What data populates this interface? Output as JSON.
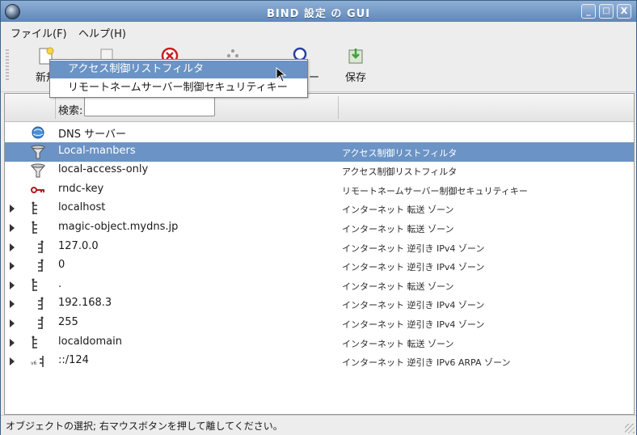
{
  "window": {
    "title": "BIND 設定 の GUI",
    "controls": [
      "_",
      "□",
      "X"
    ]
  },
  "menu": {
    "file": "ファイル(F)",
    "help": "ヘルプ(H)"
  },
  "toolbar": {
    "new_label": "新規",
    "partial_label": "ー",
    "save_label": "保存"
  },
  "popup": {
    "items": [
      "アクセス制御リストフィルタ",
      "リモートネームサーバー制御セキュリティキー"
    ]
  },
  "search": {
    "label": "検索:",
    "value": ""
  },
  "rows": [
    {
      "name": "DNS サーバー",
      "type": "",
      "icon": "globe-icon",
      "expandable": false
    },
    {
      "name": "Local-manbers",
      "type": "アクセス制御リストフィルタ",
      "icon": "filter-funnel-icon",
      "expandable": false
    },
    {
      "name": "local-access-only",
      "type": "アクセス制御リストフィルタ",
      "icon": "filter-funnel-icon",
      "expandable": false
    },
    {
      "name": "rndc-key",
      "type": "リモートネームサーバー制御セキュリティキー",
      "icon": "key-icon",
      "expandable": false
    },
    {
      "name": "localhost",
      "type": "インターネット 転送 ゾーン",
      "icon": "zone-tree-icon",
      "expandable": true
    },
    {
      "name": "magic-object.mydns.jp",
      "type": "インターネット 転送 ゾーン",
      "icon": "zone-tree-icon",
      "expandable": true
    },
    {
      "name": "127.0.0",
      "type": "インターネット 逆引き IPv4 ゾーン",
      "icon": "reverse-zone-icon",
      "expandable": true
    },
    {
      "name": "0",
      "type": "インターネット 逆引き IPv4 ゾーン",
      "icon": "reverse-zone-icon",
      "expandable": true
    },
    {
      "name": ".",
      "type": "インターネット 転送 ゾーン",
      "icon": "zone-tree-icon",
      "expandable": true
    },
    {
      "name": "192.168.3",
      "type": "インターネット 逆引き IPv4 ゾーン",
      "icon": "reverse-zone-icon",
      "expandable": true
    },
    {
      "name": "255",
      "type": "インターネット 逆引き IPv4 ゾーン",
      "icon": "reverse-zone-icon",
      "expandable": true
    },
    {
      "name": "localdomain",
      "type": "インターネット 転送 ゾーン",
      "icon": "zone-tree-icon",
      "expandable": true
    },
    {
      "name": "::/124",
      "type": "インターネット 逆引き IPv6 ARPA ゾーン",
      "icon": "ipv6-zone-icon",
      "expandable": true
    }
  ],
  "status": {
    "text": "オブジェクトの選択; 右マウスボタンを押して離してください。"
  },
  "colors": {
    "selection": "#6b93c5",
    "titlebar": "#6f95c4"
  }
}
